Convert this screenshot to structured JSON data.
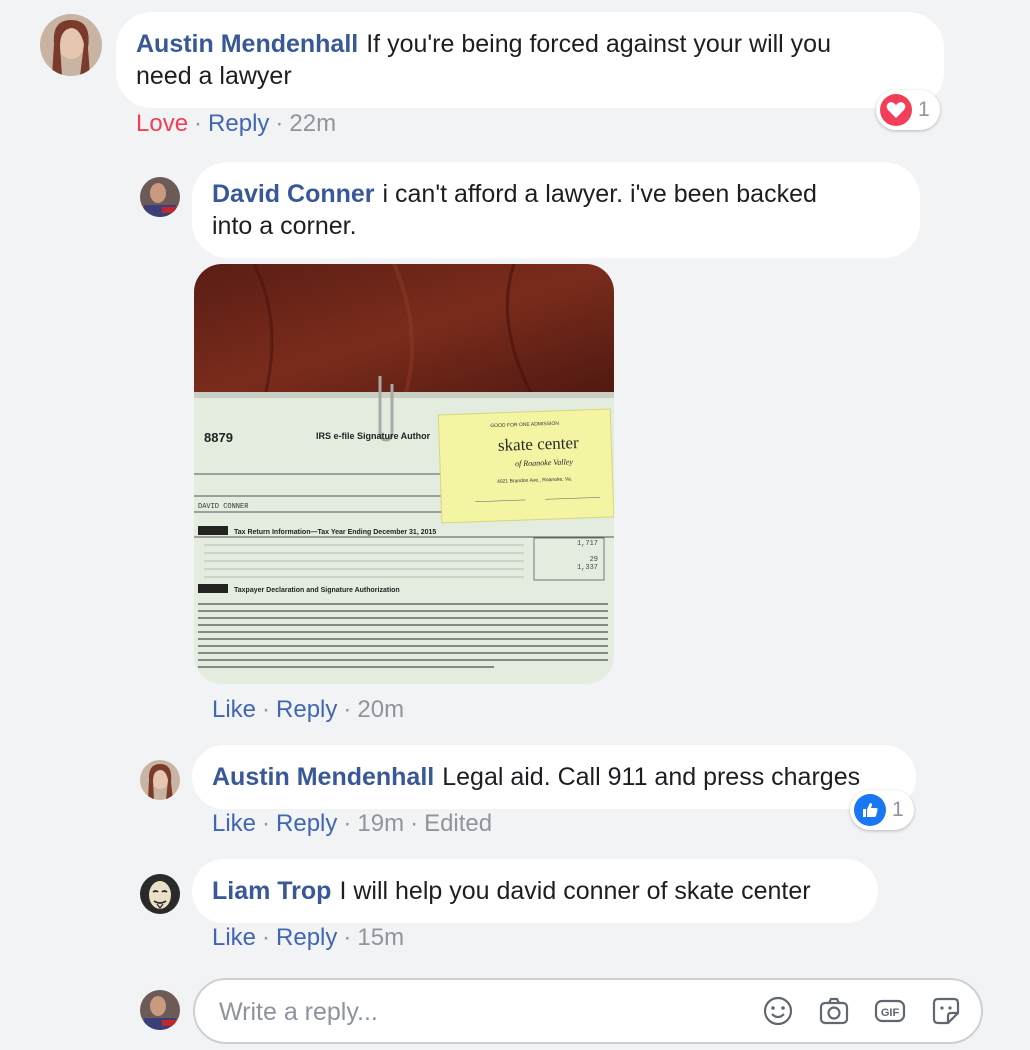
{
  "comments": [
    {
      "author": "Austin Mendenhall",
      "text_line1": "If you're being forced against your will you",
      "text_line2": "need a lawyer",
      "reaction_label": "Love",
      "reply_label": "Reply",
      "time": "22m",
      "reaction_count": "1",
      "reaction_icon": "heart-icon"
    },
    {
      "author": "David Conner",
      "text_line1": "i can't afford a lawyer. i've been backed",
      "text_line2": "into a corner.",
      "like_label": "Like",
      "reply_label": "Reply",
      "time": "20m"
    },
    {
      "author": "Austin Mendenhall",
      "text": "Legal aid. Call 911 and press charges",
      "like_label": "Like",
      "reply_label": "Reply",
      "time": "19m",
      "edited_label": "Edited",
      "reaction_count": "1",
      "reaction_icon": "thumbs-up-icon"
    },
    {
      "author": "Liam Trop",
      "text": "I will help you david conner of skate center",
      "like_label": "Like",
      "reply_label": "Reply",
      "time": "15m"
    }
  ],
  "photo": {
    "form_number": "8879",
    "form_title": "IRS e-file Signature Author",
    "taxpayer_name": "DAVID CONNER",
    "part1_title": "Tax Return Information—Tax Year Ending December 31, 2015",
    "part2_title": "Taxpayer Declaration and Signature Authorization",
    "line1_value": "1,717",
    "line3_value": "29",
    "line4_value": "1,337",
    "ticket_header": "GOOD FOR ONE ADMISSION",
    "ticket_brand": "skate center",
    "ticket_sub": "of Roanoke Valley",
    "ticket_address": "4021 Brandon Ave., Roanoke, Va."
  },
  "reply_box": {
    "placeholder": "Write a reply...",
    "icons": [
      "emoji-icon",
      "camera-icon",
      "gif-icon",
      "sticker-icon"
    ]
  },
  "colors": {
    "author": "#385898",
    "link": "#4267b2",
    "love": "#f33e58",
    "meta": "#90949c"
  }
}
